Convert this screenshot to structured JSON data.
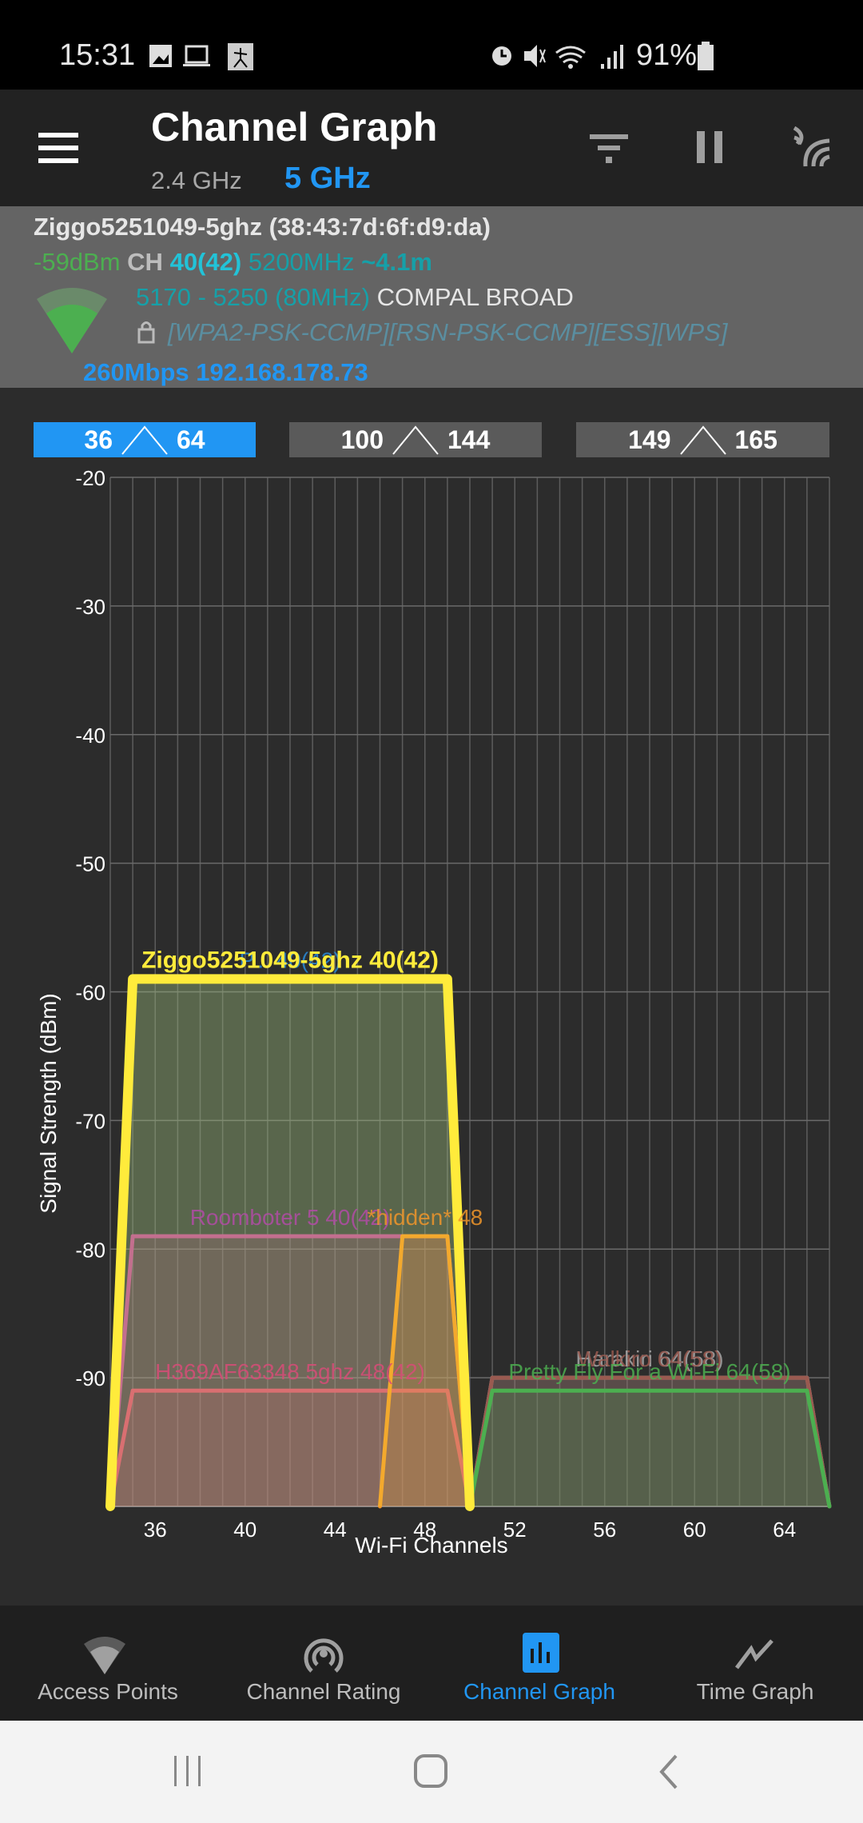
{
  "status_bar": {
    "time": "15:31",
    "battery": "91%",
    "icons_left": [
      "gallery-icon",
      "laptop-icon",
      "app-icon"
    ],
    "icons_right": [
      "alarm-icon",
      "mute-icon",
      "wifi-icon",
      "signal-icon",
      "battery-icon"
    ]
  },
  "app_bar": {
    "title": "Channel Graph",
    "bands": [
      "2.4 GHz",
      "5 GHz"
    ],
    "selected_band": "5 GHz",
    "icons": [
      "menu-icon",
      "filter-icon",
      "pause-icon",
      "wifi-scan-icon"
    ]
  },
  "connected": {
    "ssid_bssid": "Ziggo5251049-5ghz (38:43:7d:6f:d9:da)",
    "level": "-59dBm",
    "ch_label": "CH",
    "channel": "40(42)",
    "frequency": "5200MHz",
    "distance": "~4.1m",
    "range": "5170 - 5250 (80MHz)",
    "vendor": "COMPAL BROAD",
    "capabilities": "[WPA2-PSK-CCMP][RSN-PSK-CCMP][ESS][WPS]",
    "link": "260Mbps 192.168.178.73"
  },
  "ranges": [
    {
      "from": "36",
      "to": "64",
      "selected": true
    },
    {
      "from": "100",
      "to": "144",
      "selected": false
    },
    {
      "from": "149",
      "to": "165",
      "selected": false
    }
  ],
  "colors": {
    "accent": "#2196f3",
    "panel": "#646464",
    "bg": "#2c2c2c"
  },
  "chart_data": {
    "type": "area",
    "xlabel": "Wi-Fi Channels",
    "ylabel": "Signal Strength (dBm)",
    "xlim": [
      34,
      66
    ],
    "ylim": [
      -100,
      -20
    ],
    "xticks": [
      36,
      40,
      44,
      48,
      52,
      56,
      60,
      64
    ],
    "yticks": [
      -20,
      -30,
      -40,
      -50,
      -60,
      -70,
      -80,
      -90
    ],
    "grid": true,
    "series": [
      {
        "name": "P... 40(42)",
        "center": 42,
        "width_mhz": 80,
        "level": -59,
        "color": "#2a8ad8"
      },
      {
        "name": "Harakiri 64(58)",
        "center": 58,
        "width_mhz": 80,
        "level": -90,
        "color": "#a8a8a8"
      },
      {
        "name": "Walkiro 64(58)",
        "center": 58,
        "width_mhz": 80,
        "level": -90,
        "color": "#9a5a50"
      },
      {
        "name": "Pretty Fly For a Wi-Fi 64(58)",
        "center": 58,
        "width_mhz": 80,
        "level": -91,
        "color": "#4caf50"
      },
      {
        "name": "H369AF63348 5ghz 48(42)",
        "center": 42,
        "width_mhz": 80,
        "level": -91,
        "color": "#d84c78"
      },
      {
        "name": "Roomboter 5 40(42)",
        "center": 42,
        "width_mhz": 80,
        "level": -79,
        "color": "#b24ca6"
      },
      {
        "name": "*hidden* 48",
        "center": 48,
        "width_mhz": 20,
        "level": -79,
        "color": "#f0962a"
      },
      {
        "name": "Ziggo5251049-5ghz 40(42)",
        "center": 42,
        "width_mhz": 80,
        "level": -59,
        "color": "#ffeb3b",
        "highlight": true
      }
    ]
  },
  "bottom_nav": [
    {
      "label": "Access Points",
      "icon": "wifi-icon",
      "active": false
    },
    {
      "label": "Channel Rating",
      "icon": "antenna-icon",
      "active": false
    },
    {
      "label": "Channel Graph",
      "icon": "bar-chart-icon",
      "active": true
    },
    {
      "label": "Time Graph",
      "icon": "line-chart-icon",
      "active": false
    }
  ]
}
